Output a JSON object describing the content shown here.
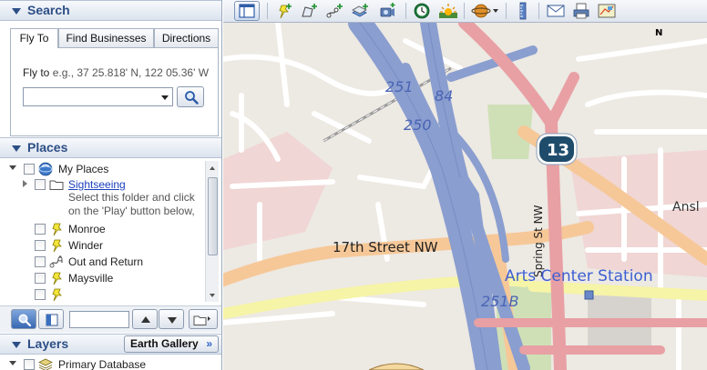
{
  "search": {
    "title": "Search",
    "tabs": [
      {
        "label": "Fly To"
      },
      {
        "label": "Find Businesses"
      },
      {
        "label": "Directions"
      }
    ],
    "fly_to_label": "Fly to",
    "fly_to_hint": "e.g., 37 25.818' N, 122 05.36' W",
    "fly_to_value": ""
  },
  "places": {
    "title": "Places",
    "items": [
      {
        "label": "My Places",
        "icon": "globe-icon"
      },
      {
        "label": "Sightseeing",
        "icon": "folder-icon"
      },
      {
        "label": "Monroe",
        "icon": "pushpin-icon"
      },
      {
        "label": "Winder",
        "icon": "pushpin-icon"
      },
      {
        "label": "Out and Return",
        "icon": "path-icon"
      },
      {
        "label": "Maysville",
        "icon": "pushpin-icon"
      },
      {
        "label": "",
        "icon": "pushpin-icon"
      }
    ],
    "sightseeing_description_line1": "Select this folder and click",
    "sightseeing_description_line2": "on the 'Play' button below,"
  },
  "layers": {
    "title": "Layers",
    "earth_gallery_label": "Earth Gallery",
    "earth_gallery_chevron": "»",
    "items": [
      {
        "label": "Primary Database"
      }
    ]
  },
  "map": {
    "labels": {
      "street_17th": "17th Street NW",
      "spring_st": "Spring St NW",
      "arts_center": "Arts Center Station",
      "ansl": "Ansl",
      "route_13": "13",
      "route_251_top": "251",
      "route_84": "84",
      "route_250": "250",
      "route_251b": "251B"
    },
    "compass": "N",
    "colors": {
      "highway": "#8a9ecf",
      "primary": "#e8a0a4",
      "secondary": "#f6c898",
      "tertiary": "#f6f4a6",
      "background": "#ede9e3",
      "residential": "#f0d6d4",
      "green": "#cfe0b7"
    }
  }
}
